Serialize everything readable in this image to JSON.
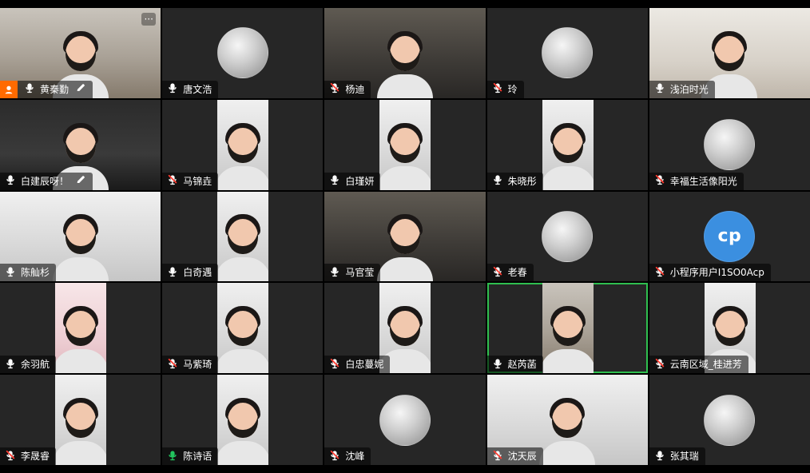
{
  "participants": [
    {
      "name": "黄秦勤",
      "mic": "on",
      "host": true,
      "video": true,
      "active": false,
      "video_style": "room"
    },
    {
      "name": "唐文浩",
      "mic": "on",
      "host": false,
      "video": false,
      "active": false
    },
    {
      "name": "杨迪",
      "mic": "muted",
      "host": false,
      "video": true,
      "active": false,
      "video_style": "brown"
    },
    {
      "name": "玲",
      "mic": "muted",
      "host": false,
      "video": false,
      "active": false
    },
    {
      "name": "浅泊时光",
      "mic": "on",
      "host": false,
      "video": true,
      "active": false,
      "video_style": "wall"
    },
    {
      "name": "白建辰呀！",
      "mic": "on",
      "host": false,
      "video": true,
      "active": false,
      "video_style": "dark",
      "editable": true
    },
    {
      "name": "马锦垚",
      "mic": "muted",
      "host": false,
      "video": true,
      "active": false,
      "video_style": "light"
    },
    {
      "name": "白瑾妍",
      "mic": "on",
      "host": false,
      "video": true,
      "active": false,
      "video_style": "light"
    },
    {
      "name": "朱晓彤",
      "mic": "on",
      "host": false,
      "video": true,
      "active": false,
      "video_style": "light"
    },
    {
      "name": "幸福生活像阳光",
      "mic": "muted",
      "host": false,
      "video": false,
      "active": false
    },
    {
      "name": "陈舢杉",
      "mic": "on",
      "host": false,
      "video": true,
      "active": false,
      "video_style": "light"
    },
    {
      "name": "白奇遇",
      "mic": "on",
      "host": false,
      "video": true,
      "active": false,
      "video_style": "light"
    },
    {
      "name": "马官莹",
      "mic": "on",
      "host": false,
      "video": true,
      "active": false,
      "video_style": "brown"
    },
    {
      "name": "老春",
      "mic": "muted",
      "host": false,
      "video": false,
      "active": false
    },
    {
      "name": "小程序用户I1SO0Acp",
      "mic": "muted",
      "host": false,
      "video": false,
      "active": false,
      "avatar_text": "cp"
    },
    {
      "name": "余羽航",
      "mic": "on",
      "host": false,
      "video": true,
      "active": false,
      "video_style": "pink"
    },
    {
      "name": "马紫琦",
      "mic": "muted",
      "host": false,
      "video": true,
      "active": false,
      "video_style": "light"
    },
    {
      "name": "白忠蔓妮",
      "mic": "muted",
      "host": false,
      "video": true,
      "active": false,
      "video_style": "light"
    },
    {
      "name": "赵芮菡",
      "mic": "on",
      "host": false,
      "video": true,
      "active": true,
      "video_style": "room"
    },
    {
      "name": "云南区域_桂进芳",
      "mic": "muted",
      "host": false,
      "video": true,
      "active": false,
      "video_style": "light"
    },
    {
      "name": "李晟睿",
      "mic": "muted",
      "host": false,
      "video": true,
      "active": false,
      "video_style": "light"
    },
    {
      "name": "陈诗语",
      "mic": "on_green",
      "host": false,
      "video": true,
      "active": false,
      "video_style": "light"
    },
    {
      "name": "沈峰",
      "mic": "muted",
      "host": false,
      "video": false,
      "active": false
    },
    {
      "name": "沈天辰",
      "mic": "muted",
      "host": false,
      "video": true,
      "active": false,
      "video_style": "light"
    },
    {
      "name": "张其瑞",
      "mic": "on",
      "host": false,
      "video": false,
      "active": false
    }
  ],
  "ui": {
    "more_label": "···"
  },
  "colors": {
    "tile_bg": "#262626",
    "active_border": "#2fbf4f",
    "mute_red": "#ff3b30",
    "mic_green": "#22c55e",
    "host_orange": "#ff6a00",
    "cp_blue": "#3b8fe0"
  }
}
